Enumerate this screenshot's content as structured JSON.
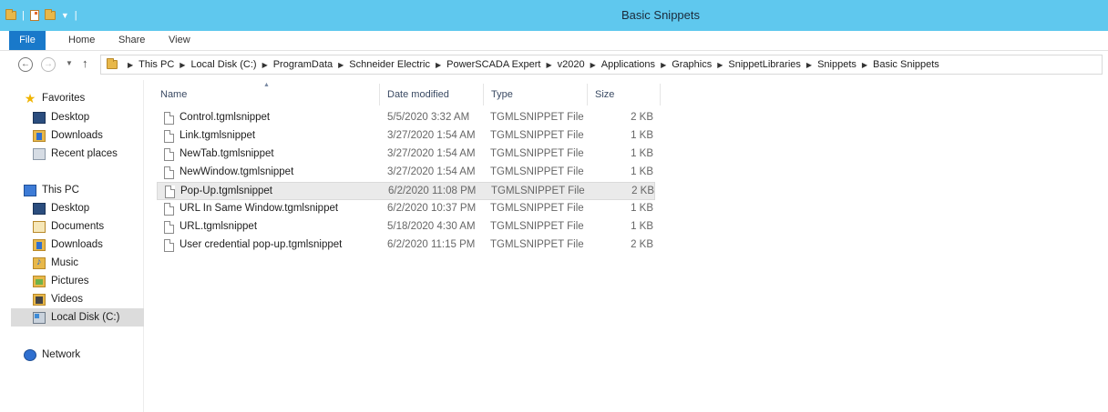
{
  "window": {
    "title": "Basic Snippets"
  },
  "ribbon": {
    "tabs": [
      "File",
      "Home",
      "Share",
      "View"
    ]
  },
  "address": {
    "crumbs": [
      "This PC",
      "Local Disk (C:)",
      "ProgramData",
      "Schneider Electric",
      "PowerSCADA Expert",
      "v2020",
      "Applications",
      "Graphics",
      "SnippetLibraries",
      "Snippets",
      "Basic Snippets"
    ]
  },
  "nav": {
    "favorites": {
      "label": "Favorites",
      "items": [
        "Desktop",
        "Downloads",
        "Recent places"
      ]
    },
    "this_pc": {
      "label": "This PC",
      "items": [
        "Desktop",
        "Documents",
        "Downloads",
        "Music",
        "Pictures",
        "Videos",
        "Local Disk (C:)"
      ]
    },
    "network": {
      "label": "Network"
    },
    "selected": "Local Disk (C:)"
  },
  "columns": {
    "name": "Name",
    "date": "Date modified",
    "type": "Type",
    "size": "Size"
  },
  "files": [
    {
      "name": "Control.tgmlsnippet",
      "date": "5/5/2020 3:32 AM",
      "type": "TGMLSNIPPET File",
      "size": "2 KB"
    },
    {
      "name": "Link.tgmlsnippet",
      "date": "3/27/2020 1:54 AM",
      "type": "TGMLSNIPPET File",
      "size": "1 KB"
    },
    {
      "name": "NewTab.tgmlsnippet",
      "date": "3/27/2020 1:54 AM",
      "type": "TGMLSNIPPET File",
      "size": "1 KB"
    },
    {
      "name": "NewWindow.tgmlsnippet",
      "date": "3/27/2020 1:54 AM",
      "type": "TGMLSNIPPET File",
      "size": "1 KB"
    },
    {
      "name": "Pop-Up.tgmlsnippet",
      "date": "6/2/2020 11:08 PM",
      "type": "TGMLSNIPPET File",
      "size": "2 KB"
    },
    {
      "name": "URL In Same Window.tgmlsnippet",
      "date": "6/2/2020 10:37 PM",
      "type": "TGMLSNIPPET File",
      "size": "1 KB"
    },
    {
      "name": "URL.tgmlsnippet",
      "date": "5/18/2020 4:30 AM",
      "type": "TGMLSNIPPET File",
      "size": "1 KB"
    },
    {
      "name": "User credential pop-up.tgmlsnippet",
      "date": "6/2/2020 11:15 PM",
      "type": "TGMLSNIPPET File",
      "size": "2 KB"
    }
  ],
  "highlighted_file": "Pop-Up.tgmlsnippet",
  "colors": {
    "titlebar": "#5fc8ee",
    "file_tab": "#1979ca",
    "star": "#f0b400"
  }
}
